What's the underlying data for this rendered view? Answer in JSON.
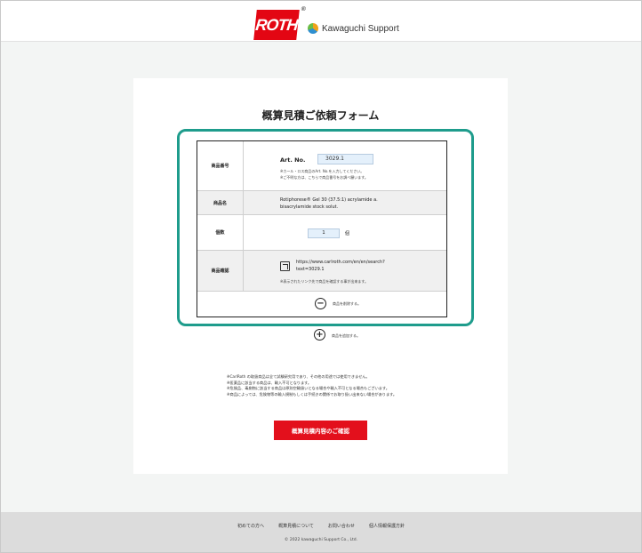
{
  "header": {
    "roth_logo": "ROTH",
    "roth_reg": "®",
    "kawaguchi_logo": "Kawaguchi Support"
  },
  "form": {
    "title": "概算見積ご依頼フォーム",
    "rows": {
      "artno": {
        "label": "商品番号",
        "field_label": "Art. No.",
        "value": "3029.1",
        "hint1": "※カール・ロス商品のArt. No.を入力してください。",
        "hint2": "※ご不明な方は、こちらで商品番号をお調べ願います。"
      },
      "name": {
        "label": "商品名",
        "value": "Rotiphorese® Gel 30 (37.5:1) acrylamide a. bisacrylamide stock solut."
      },
      "qty": {
        "label": "個数",
        "value": "1",
        "unit": "個"
      },
      "confirm": {
        "label": "商品確認",
        "url": "https://www.carlroth.com/en/en/search?text=3029.1",
        "note": "※表示されたリンク先で商品を確認する事が出来ます。"
      }
    },
    "remove_text": "商品を削除する。",
    "add_text": "商品を追加する。",
    "notes": [
      "※CarlRoth の取扱商品は全て試験研究用であり、その他の用途では使用できません。",
      "※医薬品に該当する商品は、輸入不可となります。",
      "※危険品、毒劇物に該当する商品は原則空輸扱いとなる場合や輸入不可となる場合もございます。",
      "※商品によっては、危険物等の輸入規制もしくは手続きの関係でお取り扱い出来ない場合があります。"
    ],
    "submit_label": "概算見積内容のご確認"
  },
  "footer": {
    "links": [
      "初めての方へ",
      "概算見積について",
      "お問い合わせ",
      "個人情報保護方針"
    ],
    "copyright": "© 2022 kawaguchi Support Co., Ltd."
  },
  "colors": {
    "accent_teal": "#1e9c8c",
    "brand_red": "#e30613",
    "input_blue": "#e4f0fb"
  }
}
